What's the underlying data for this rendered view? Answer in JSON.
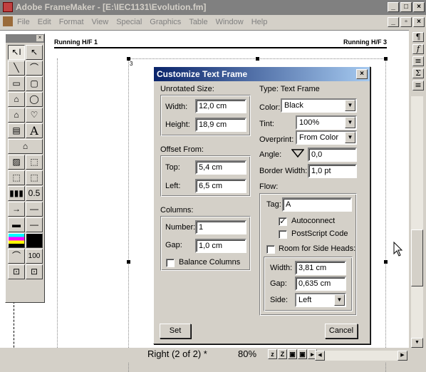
{
  "window": {
    "title": "Adobe FrameMaker - [E:\\IEC1131\\Evolution.fm]",
    "min": "_",
    "max": "□",
    "close": "×"
  },
  "menu": [
    "File",
    "Edit",
    "Format",
    "View",
    "Special",
    "Graphics",
    "Table",
    "Window",
    "Help"
  ],
  "document": {
    "header_left": "Running H/F 1",
    "header_right": "Running H/F 3",
    "frame_number": "3"
  },
  "right_toolbar": [
    "¶",
    "f",
    "≡",
    "Σ",
    "≡"
  ],
  "palette": {
    "tools": [
      "↖I",
      "↖",
      "╲",
      "⌒",
      "▭",
      "▢",
      "⌂",
      "◯",
      "⌂",
      "♡",
      "▤",
      "A",
      "⌂",
      "",
      "▨",
      "⬚",
      "⬚",
      "⬚",
      "▮▮▮",
      "0.5",
      "→",
      "—",
      "▬",
      "—",
      "▦",
      "■",
      "⌒",
      "100",
      "⊡",
      "⊡"
    ]
  },
  "dialog": {
    "title": "Customize Text Frame",
    "unrotated_size_label": "Unrotated Size:",
    "width_label": "Width:",
    "width_value": "12,0 cm",
    "height_label": "Height:",
    "height_value": "18,9 cm",
    "offset_from_label": "Offset From:",
    "top_label": "Top:",
    "top_value": "5,4 cm",
    "left_label": "Left:",
    "left_value": "6,5 cm",
    "columns_label": "Columns:",
    "number_label": "Number:",
    "number_value": "1",
    "gap_label": "Gap:",
    "gap_value": "1,0 cm",
    "balance_columns_label": "Balance Columns",
    "type_label": "Type:  Text Frame",
    "color_label": "Color:",
    "color_value": "Black",
    "tint_label": "Tint:",
    "tint_value": "100%",
    "overprint_label": "Overprint:",
    "overprint_value": "From Color",
    "angle_label": "Angle:",
    "angle_value": "0,0",
    "border_width_label": "Border Width:",
    "border_width_value": "1,0 pt",
    "flow_label": "Flow:",
    "tag_label": "Tag:",
    "tag_value": "A",
    "autoconnect_label": "Autoconnect",
    "autoconnect_checked": true,
    "postscript_code_label": "PostScript Code",
    "room_side_heads_label": "Room for Side Heads:",
    "side_width_label": "Width:",
    "side_width_value": "3,81 cm",
    "side_gap_label": "Gap:",
    "side_gap_value": "0,635 cm",
    "side_label": "Side:",
    "side_value": "Left",
    "set_button": "Set",
    "cancel_button": "Cancel",
    "close": "×"
  },
  "status": {
    "page": "Right (2 of 2) *",
    "zoom": "80%",
    "icons": [
      "z",
      "Z"
    ]
  }
}
